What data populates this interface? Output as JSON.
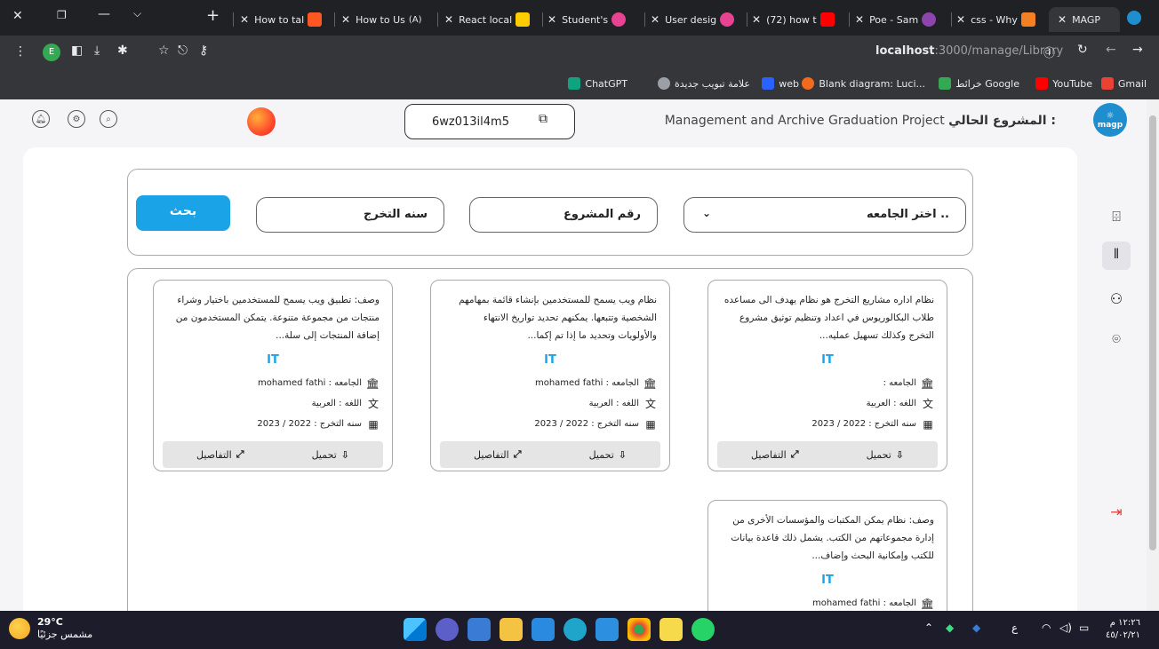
{
  "browser": {
    "tabs": [
      {
        "label": "How to tal",
        "color": "#ff5722"
      },
      {
        "label": "How to Us",
        "color": "#444"
      },
      {
        "label": "React local",
        "color": "#ffcc00"
      },
      {
        "label": "Student's",
        "color": "#e84393"
      },
      {
        "label": "User desig",
        "color": "#e84393"
      },
      {
        "label": "(72) how t",
        "color": "#ff0000"
      },
      {
        "label": "Poe - Sam",
        "color": "#8e44ad"
      },
      {
        "label": "css - Why",
        "color": "#f48024"
      },
      {
        "label": "MAGP",
        "color": "#1f8ecf"
      }
    ],
    "url_host": "localhost",
    "url_path": ":3000/manage/Library",
    "bookmarks": [
      {
        "label": "Gmail",
        "color": "#ea4335"
      },
      {
        "label": "YouTube",
        "color": "#ff0000"
      },
      {
        "label": "خرائط Google",
        "color": "#34a853"
      },
      {
        "label": "Blank diagram: Luci...",
        "color": "#f26b1d"
      },
      {
        "label": "web",
        "color": "#2962ff"
      },
      {
        "label": "علامة تبويب جديدة",
        "color": "#9aa0a6"
      },
      {
        "label": "ChatGPT",
        "color": "#10a37f"
      }
    ]
  },
  "topbar": {
    "code": "6wz013il4m5",
    "project_prefix": "المشروع الحالي :",
    "project_name": "Management and Archive Graduation Project",
    "logo_text": "magp"
  },
  "search": {
    "university_placeholder": "اختر الجامعه ..",
    "project_number_placeholder": "رقم المشروع",
    "grad_year_placeholder": "سنه التخرج",
    "button": "بحث"
  },
  "cards": [
    {
      "desc": "نظام اداره مشاريع التخرج هو نظام يهدف الى مساعده طلاب البكالوريوس في اعداد وتنظيم توثيق مشروع التخرج وكذلك تسهيل عمليه...",
      "tag": "IT",
      "university": "الجامعه :",
      "language": "اللغه : العربية",
      "year": "سنه التخرج : 2022 / 2023",
      "download": "تحميل",
      "details": "التفاصيل"
    },
    {
      "desc": "نظام ويب يسمح للمستخدمين بإنشاء قائمة بمهامهم الشخصية وتتبعها. يمكنهم تحديد تواريخ الانتهاء والأولويات وتحديد ما إذا تم إكما...",
      "tag": "IT",
      "university": "الجامعه : mohamed fathi",
      "language": "اللغه : العربية",
      "year": "سنه التخرج : 2022 / 2023",
      "download": "تحميل",
      "details": "التفاصيل"
    },
    {
      "desc": "وصف: تطبيق ويب يسمح للمستخدمين باختيار وشراء منتجات من مجموعة متنوعة. يتمكن المستخدمون من إضافة المنتجات إلى سلة...",
      "tag": "IT",
      "university": "الجامعه : mohamed fathi",
      "language": "اللغه : العربية",
      "year": "سنه التخرج : 2022 / 2023",
      "download": "تحميل",
      "details": "التفاصيل"
    },
    {
      "desc": "وصف: نظام يمكن المكتبات والمؤسسات الأخرى من إدارة مجموعاتهم من الكتب. يشمل ذلك قاعدة بيانات للكتب وإمكانية البحث وإضاف...",
      "tag": "IT",
      "university": "الجامعه : mohamed fathi"
    }
  ],
  "taskbar": {
    "temp": "29°C",
    "weather": "مشمس جزئيًا",
    "time": "١٢:٢٦ م",
    "date": "٤٥/٠٢/٢١"
  }
}
